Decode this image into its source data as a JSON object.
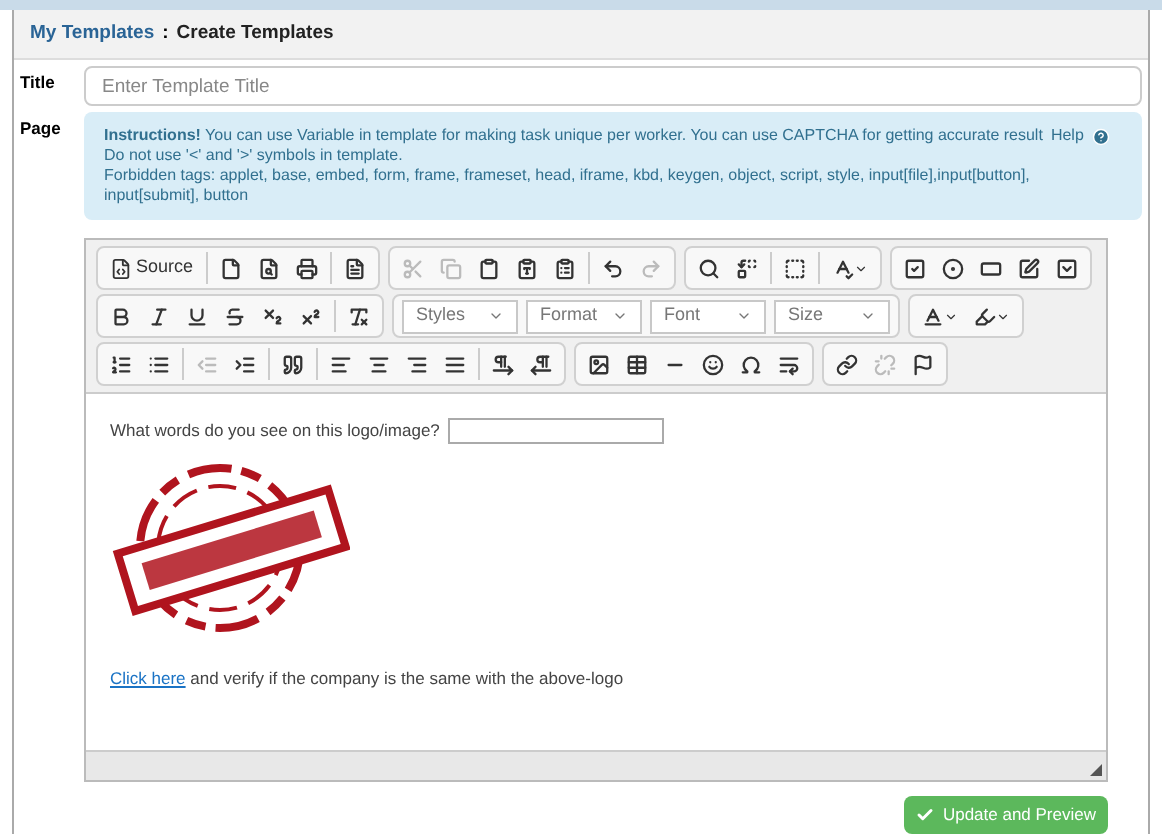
{
  "breadcrumb": {
    "link": "My Templates",
    "separator": ":",
    "current": "Create Templates"
  },
  "title_field": {
    "label": "Title",
    "placeholder": "Enter Template Title"
  },
  "page_label": "Page",
  "instructions": {
    "text": "**Instructions!** You can use Variable in template for making task unique per worker. You can use CAPTCHA for getting accurate result",
    "help": "Help",
    "lines": [
      "Do not use '<' and '>' symbols in template.",
      "Forbidden tags: applet, base, embed, form, frame, frameset, head, iframe, kbd, keygen, object, script, style, input[file],input[button], input[submit], button"
    ]
  },
  "toolbar": {
    "rows": [
      [
        [
          {
            "kind": "source",
            "label": "Source",
            "disabled": false
          },
          {
            "kind": "sep"
          },
          {
            "kind": "icon",
            "disabled": false
          },
          {
            "kind": "icon",
            "disabled": false
          },
          {
            "kind": "icon",
            "disabled": false
          },
          {
            "kind": "sep"
          },
          {
            "kind": "icon",
            "disabled": false
          }
        ],
        [
          {
            "kind": "icon",
            "disabled": true
          },
          {
            "kind": "icon",
            "disabled": true
          },
          {
            "kind": "icon",
            "disabled": false
          },
          {
            "kind": "icon",
            "disabled": false
          },
          {
            "kind": "icon",
            "disabled": false
          },
          {
            "kind": "sep"
          },
          {
            "kind": "icon",
            "disabled": false
          },
          {
            "kind": "icon",
            "disabled": true
          }
        ],
        [
          {
            "kind": "icon",
            "disabled": false
          },
          {
            "kind": "icon",
            "disabled": false
          },
          {
            "kind": "sep"
          },
          {
            "kind": "icon",
            "disabled": false
          },
          {
            "kind": "sep"
          },
          {
            "kind": "menu",
            "disabled": false
          }
        ],
        [
          {
            "kind": "icon",
            "disabled": false
          },
          {
            "kind": "icon",
            "disabled": false
          },
          {
            "kind": "icon",
            "disabled": false
          },
          {
            "kind": "icon",
            "disabled": false
          },
          {
            "kind": "icon",
            "disabled": false
          }
        ]
      ],
      [
        [
          {
            "kind": "icon",
            "disabled": false
          },
          {
            "kind": "icon",
            "disabled": false
          },
          {
            "kind": "icon",
            "disabled": false
          },
          {
            "kind": "icon",
            "disabled": false
          },
          {
            "kind": "icon",
            "disabled": false
          },
          {
            "kind": "icon",
            "disabled": false
          },
          {
            "kind": "sep"
          },
          {
            "kind": "icon",
            "disabled": false
          }
        ],
        [
          {
            "kind": "combo",
            "label": "Styles",
            "disabled": false
          },
          {
            "kind": "combo",
            "label": "Format",
            "disabled": false
          },
          {
            "kind": "combo",
            "label": "Font",
            "disabled": false
          },
          {
            "kind": "combo",
            "label": "Size",
            "disabled": false
          }
        ],
        [
          {
            "kind": "menu",
            "disabled": false
          },
          {
            "kind": "menu",
            "disabled": false
          }
        ]
      ],
      [
        [
          {
            "kind": "icon",
            "disabled": false
          },
          {
            "kind": "icon",
            "disabled": false
          },
          {
            "kind": "sep"
          },
          {
            "kind": "icon",
            "disabled": true
          },
          {
            "kind": "icon",
            "disabled": false
          },
          {
            "kind": "sep"
          },
          {
            "kind": "icon",
            "disabled": false
          },
          {
            "kind": "sep"
          },
          {
            "kind": "icon",
            "disabled": false
          },
          {
            "kind": "icon",
            "disabled": false
          },
          {
            "kind": "icon",
            "disabled": false
          },
          {
            "kind": "icon",
            "disabled": false
          },
          {
            "kind": "sep"
          },
          {
            "kind": "icon",
            "disabled": false
          },
          {
            "kind": "icon",
            "disabled": false
          }
        ],
        [
          {
            "kind": "icon",
            "disabled": false
          },
          {
            "kind": "icon",
            "disabled": false
          },
          {
            "kind": "icon",
            "disabled": false
          },
          {
            "kind": "icon",
            "disabled": false
          },
          {
            "kind": "icon",
            "disabled": false
          },
          {
            "kind": "icon",
            "disabled": false
          }
        ],
        [
          {
            "kind": "icon",
            "disabled": false
          },
          {
            "kind": "icon",
            "disabled": true
          },
          {
            "kind": "icon",
            "disabled": false
          }
        ]
      ]
    ]
  },
  "content": {
    "question": "What words do you see on this logo/image?",
    "link": "Click here",
    "sentence_rest": "and verify if the company is the same with the above-logo"
  },
  "submit": {
    "label": "Update and Preview"
  }
}
